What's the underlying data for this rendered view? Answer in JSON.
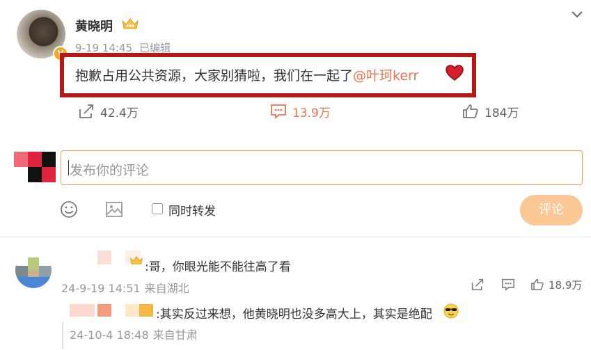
{
  "post": {
    "username": "黄晓明",
    "timestamp": "9-19 14:45",
    "edited": "已编辑",
    "text": "抱歉占用公共资源，大家别猜啦，我们在一起了",
    "mention": "@叶珂kerr",
    "verified_badge": "V",
    "icons": {
      "crown": "crown-icon",
      "heart": "heart-icon",
      "menu": "chevron-down-icon"
    }
  },
  "actions": {
    "shares": "42.4万",
    "comments": "13.9万",
    "likes": "184万"
  },
  "composer": {
    "placeholder": "发布你的评论",
    "repost_label": "同时转发",
    "submit_label": "评论"
  },
  "comments": [
    {
      "text": ":哥，你眼光能不能往高了看",
      "date": "24-9-19 14:51",
      "location": "来自湖北",
      "likes": "18.9万",
      "reply": {
        "text": ":其实反过来想，他黄晓明也没多高大上，其实是绝配",
        "date": "24-10-4 18:48",
        "location": "来自甘肃"
      }
    }
  ],
  "colors": {
    "accent": "#eb7350",
    "highlight_box": "#b41818",
    "button_disabled": "#fbc794",
    "input_border": "#f2a14d"
  }
}
